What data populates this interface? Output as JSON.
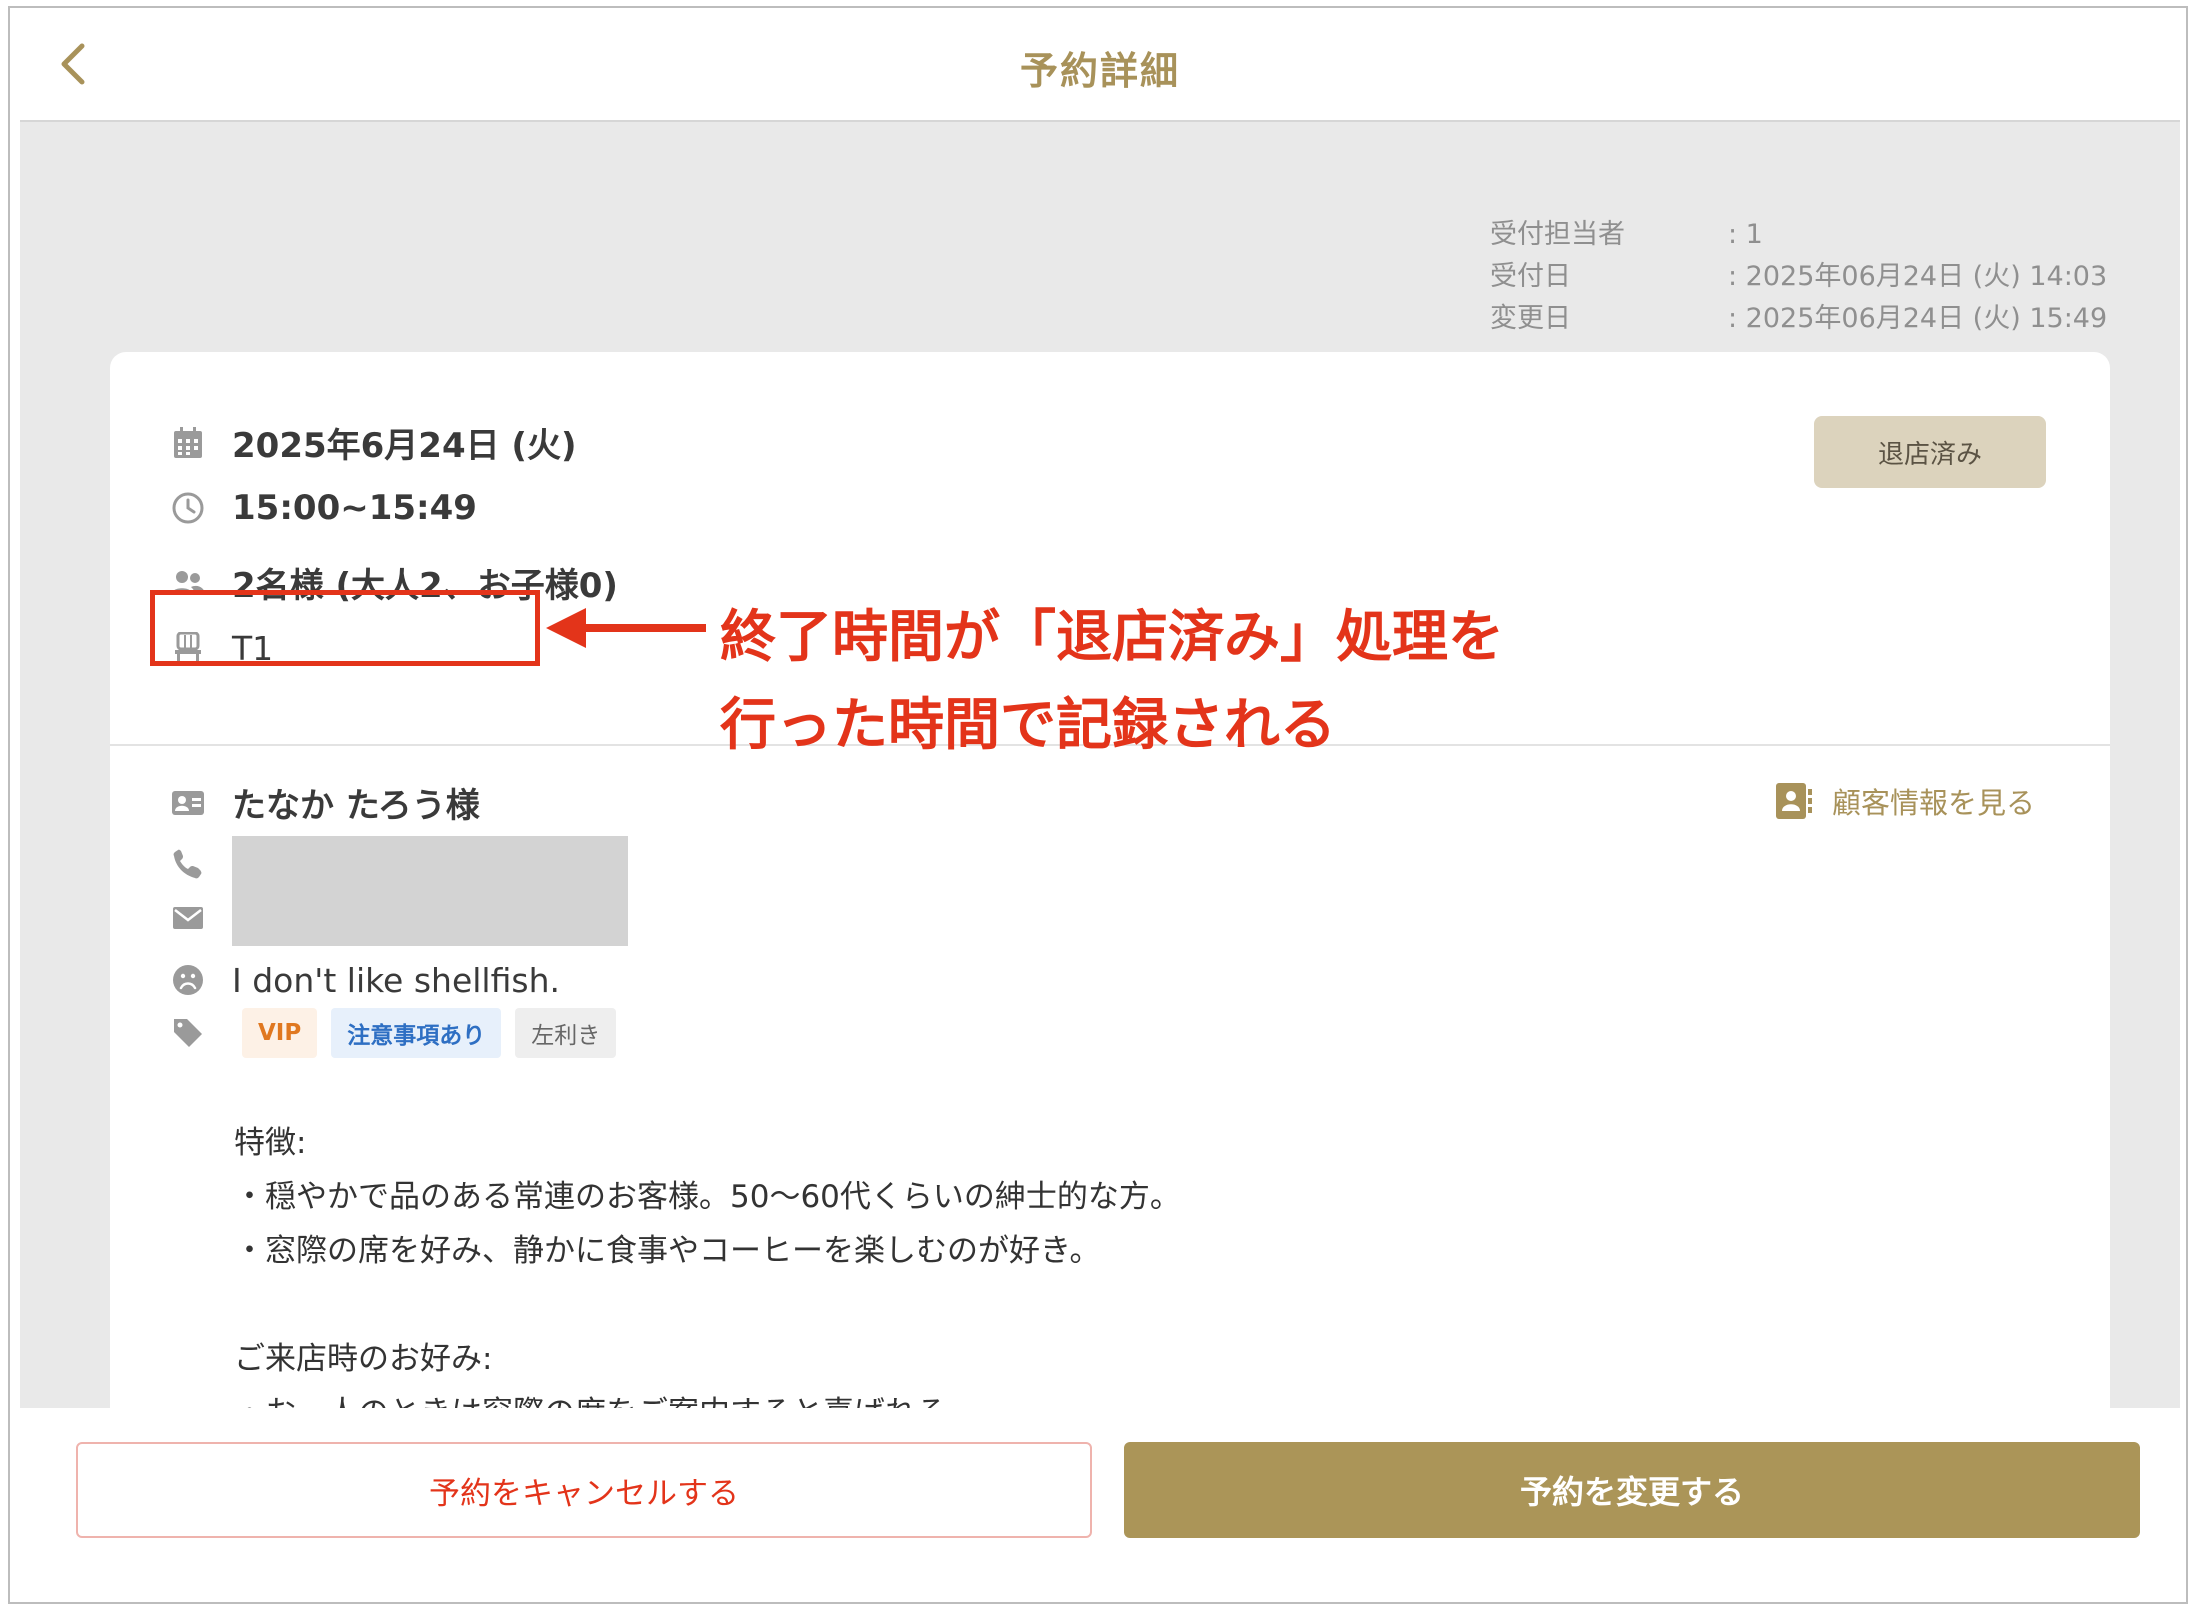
{
  "header": {
    "title": "予約詳細"
  },
  "meta": {
    "rows": [
      {
        "label": "受付担当者",
        "value": ": 1"
      },
      {
        "label": "受付日",
        "value": ": 2025年06月24日 (火) 14:03"
      },
      {
        "label": "変更日",
        "value": ": 2025年06月24日 (火) 15:49"
      }
    ]
  },
  "reservation": {
    "date": "2025年6月24日 (火)",
    "time": "15:00~15:49",
    "party": "2名様 (大人2、お子様0)",
    "table": "T1",
    "status": "退店済み"
  },
  "customer": {
    "name": "たなか たろう様",
    "allergy": "I don't like shellfish.",
    "view_label": "顧客情報を見る",
    "tags": [
      "VIP",
      "注意事項あり",
      "左利き"
    ],
    "notes": "特徴:\n・穏やかで品のある常連のお客様。50〜60代くらいの紳士的な方。\n・窓際の席を好み、静かに食事やコーヒーを楽しむのが好き。\n\nご来店時のお好み:\n・お一人のときは窓際の席をご案内すると喜ばれる"
  },
  "annotation": {
    "line1": "終了時間が「退店済み」処理を",
    "line2": "行った時間で記録される"
  },
  "footer": {
    "cancel_label": "予約をキャンセルする",
    "change_label": "予約を変更する"
  },
  "colors": {
    "accent": "#ab9558",
    "annotation": "#e3341a"
  }
}
